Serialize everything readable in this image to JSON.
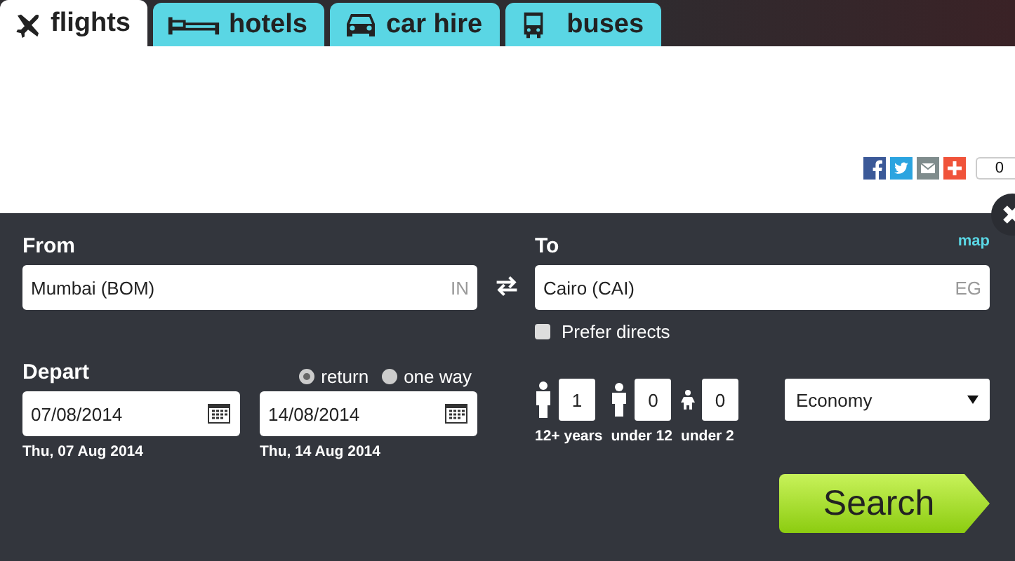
{
  "tabs": [
    {
      "label": "flights",
      "kind": "plane",
      "selected": true
    },
    {
      "label": "hotels",
      "kind": "bed",
      "selected": false
    },
    {
      "label": "car hire",
      "kind": "car",
      "selected": false
    },
    {
      "label": "buses",
      "kind": "bus",
      "selected": false
    }
  ],
  "share": {
    "count": "0"
  },
  "search_form": {
    "from": {
      "label": "From",
      "value": "Mumbai (BOM)",
      "country": "IN"
    },
    "to": {
      "label": "To",
      "value": "Cairo (CAI)",
      "country": "EG"
    },
    "map_link": "map",
    "prefer_directs": {
      "label": "Prefer directs",
      "checked": false
    },
    "depart": {
      "label": "Depart",
      "value": "07/08/2014",
      "day": "Thu, 07 Aug 2014"
    },
    "trip_types": [
      {
        "label": "return",
        "selected": true
      },
      {
        "label": "one way",
        "selected": false
      }
    ],
    "return": {
      "value": "14/08/2014",
      "day": "Thu, 14 Aug 2014"
    },
    "passengers": [
      {
        "kind": "adult",
        "value": "1",
        "label": "12+ years"
      },
      {
        "kind": "child",
        "value": "0",
        "label": "under 12"
      },
      {
        "kind": "infant",
        "value": "0",
        "label": "under 2"
      }
    ],
    "cabin": {
      "value": "Economy"
    },
    "search_button": "Search"
  }
}
